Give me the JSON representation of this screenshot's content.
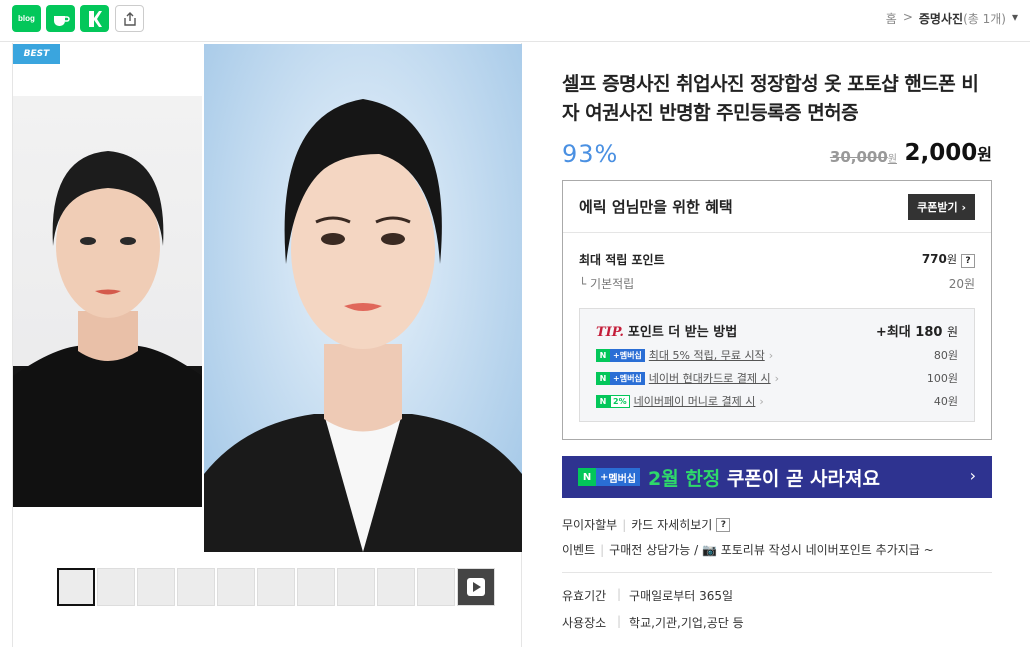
{
  "topbar": {
    "icons": [
      "blog",
      "cafe",
      "kakaostory",
      "share"
    ],
    "blog_label": "blog",
    "breadcrumb": {
      "home": "홈",
      "sep": ">",
      "current": "증명사진",
      "count": "(총 1개)"
    }
  },
  "gallery": {
    "badge": "BEST",
    "thumbnail_count": 12
  },
  "product": {
    "title": "셀프 증명사진 취업사진 정장합성 옷 포토샵 핸드폰 비자 여권사진 반명함 주민등록증 면허증",
    "discount_rate": "93%",
    "original_price": "30,000",
    "original_unit": "원",
    "sale_price": "2,000",
    "sale_unit": "원"
  },
  "benefit": {
    "heading": "에릭 엄님만을 위한 혜택",
    "coupon_button": "쿠폰받기 ›",
    "max_points_label": "최대 적립 포인트",
    "max_points_value": "770",
    "points_unit": "원",
    "base_label": "기본적립",
    "base_value": "20원",
    "tip": {
      "mark": "TIP.",
      "heading": "포인트 더 받는 방법",
      "max": "+최대",
      "max_value": "180",
      "max_unit": "원",
      "items": [
        {
          "text": "최대 5% 적립, 무료 시작",
          "value": "80원",
          "badge": "멤버십"
        },
        {
          "text": "네이버 현대카드로 결제 시",
          "value": "100원",
          "badge": "멤버십"
        },
        {
          "text": "네이버페이 머니로 결제 시",
          "value": "40원",
          "badge": "2%"
        }
      ]
    }
  },
  "banner": {
    "badge": "멤버십",
    "pre": "2월 한정",
    "post": " 쿠폰이 곧 사라져요",
    "arrow": "›"
  },
  "details": {
    "installment": "무이자할부",
    "card_details": "카드 자세히보기",
    "event_label": "이벤트",
    "event_text": "구매전 상담가능 / 📷 포토리뷰 작성시 네이버포인트 추가지급 ~",
    "validity_label": "유효기간",
    "validity_value": "구매일로부터 365일",
    "place_label": "사용장소",
    "place_value": "학교,기관,기업,공단 등"
  },
  "colors": {
    "naver_green": "#03c75a",
    "discount_blue": "#4a90e2",
    "banner_navy": "#2e3390"
  }
}
